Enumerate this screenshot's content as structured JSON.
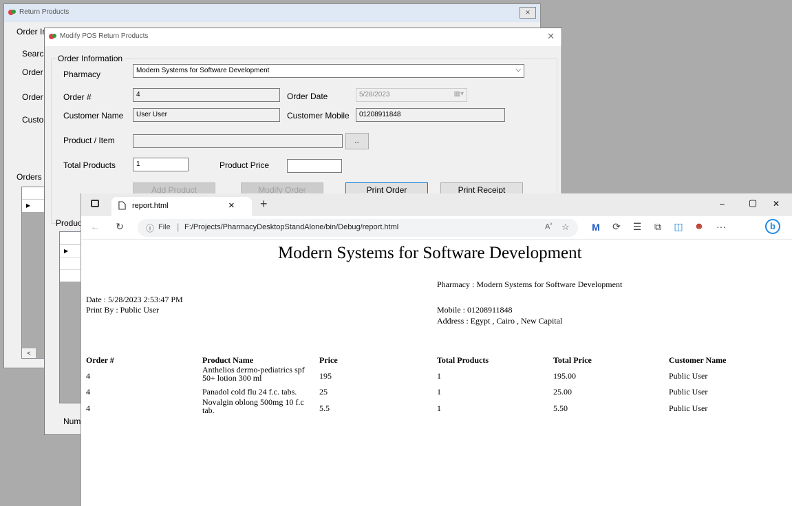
{
  "return_window": {
    "title": "Return Products",
    "order_group": "Order Information",
    "labels": [
      "Searc",
      "Order",
      "Order",
      "Custo"
    ],
    "orders_label": "Orders I",
    "products_label": "Produc",
    "num_label": "Num",
    "scroll_left": "<"
  },
  "modify_window": {
    "title": "Modify POS Return Products",
    "group_title": "Order Information",
    "pharmacy_label": "Pharmacy",
    "pharmacy_value": "Modern Systems for Software Development",
    "order_no_label": "Order #",
    "order_no_value": "4",
    "order_date_label": "Order Date",
    "order_date_value": "5/28/2023",
    "customer_name_label": "Customer Name",
    "customer_name_value": "User User",
    "customer_mobile_label": "Customer Mobile",
    "customer_mobile_value": "01208911848",
    "product_label": "Product / Item",
    "product_value": "",
    "browse_label": "...",
    "total_products_label": "Total Products",
    "total_products_value": "1",
    "product_price_label": "Product Price",
    "product_price_value": "",
    "buttons": {
      "add": "Add Product",
      "modify": "Modify Order",
      "print_order": "Print Order",
      "print_receipt": "Print Receipt"
    }
  },
  "browser": {
    "tab_title": "report.html",
    "new_tab": "+",
    "close_tab": "×",
    "url_scheme": "File",
    "url": "F:/Projects/PharmacyDesktopStandAlone/bin/Debug/report.html",
    "window_controls": {
      "minimize": "–",
      "maximize": "▢",
      "close": "✕"
    },
    "more": "···"
  },
  "report": {
    "title": "Modern Systems for Software Development",
    "pharmacy": "Pharmacy : Modern Systems for Software Development",
    "date": "Date : 5/28/2023 2:53:47 PM",
    "print_by": "Print By :  Public User",
    "mobile": "Mobile :  01208911848",
    "address": "Address :  Egypt , Cairo , New Capital",
    "columns": [
      "Order #",
      "Product Name",
      "Price",
      "Total Products",
      "Total Price",
      "Customer Name"
    ],
    "rows": [
      [
        "4",
        "Anthelios dermo-pediatrics spf 50+ lotion 300 ml",
        "195",
        "1",
        "195.00",
        "Public User"
      ],
      [
        "4",
        "Panadol cold flu 24 f.c. tabs.",
        "25",
        "1",
        "25.00",
        "Public User"
      ],
      [
        "4",
        "Novalgin oblong 500mg 10 f.c tab.",
        "5.5",
        "1",
        "5.50",
        "Public User"
      ]
    ]
  }
}
